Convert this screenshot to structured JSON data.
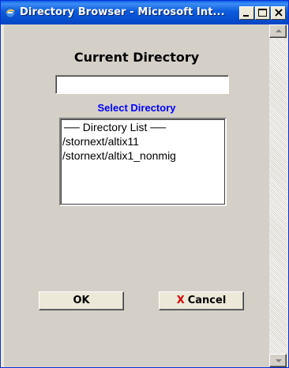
{
  "window": {
    "title": "Directory Browser - Microsoft Int...",
    "controls": {
      "minimize": "minimize",
      "maximize": "maximize",
      "close": "×"
    }
  },
  "page": {
    "heading": "Current Directory",
    "current_directory_value": "",
    "select_label": "Select Directory",
    "list_items": [
      "── Directory List ──",
      "/stornext/altix11",
      "/stornext/altix1_nonmig"
    ]
  },
  "buttons": {
    "ok_label": "OK",
    "cancel_icon": "X",
    "cancel_label": "Cancel"
  },
  "colors": {
    "titlebar": "#0b5bdc",
    "select_label": "#0000ff",
    "cancel_icon": "#d40000",
    "background": "#d4d0c8"
  }
}
